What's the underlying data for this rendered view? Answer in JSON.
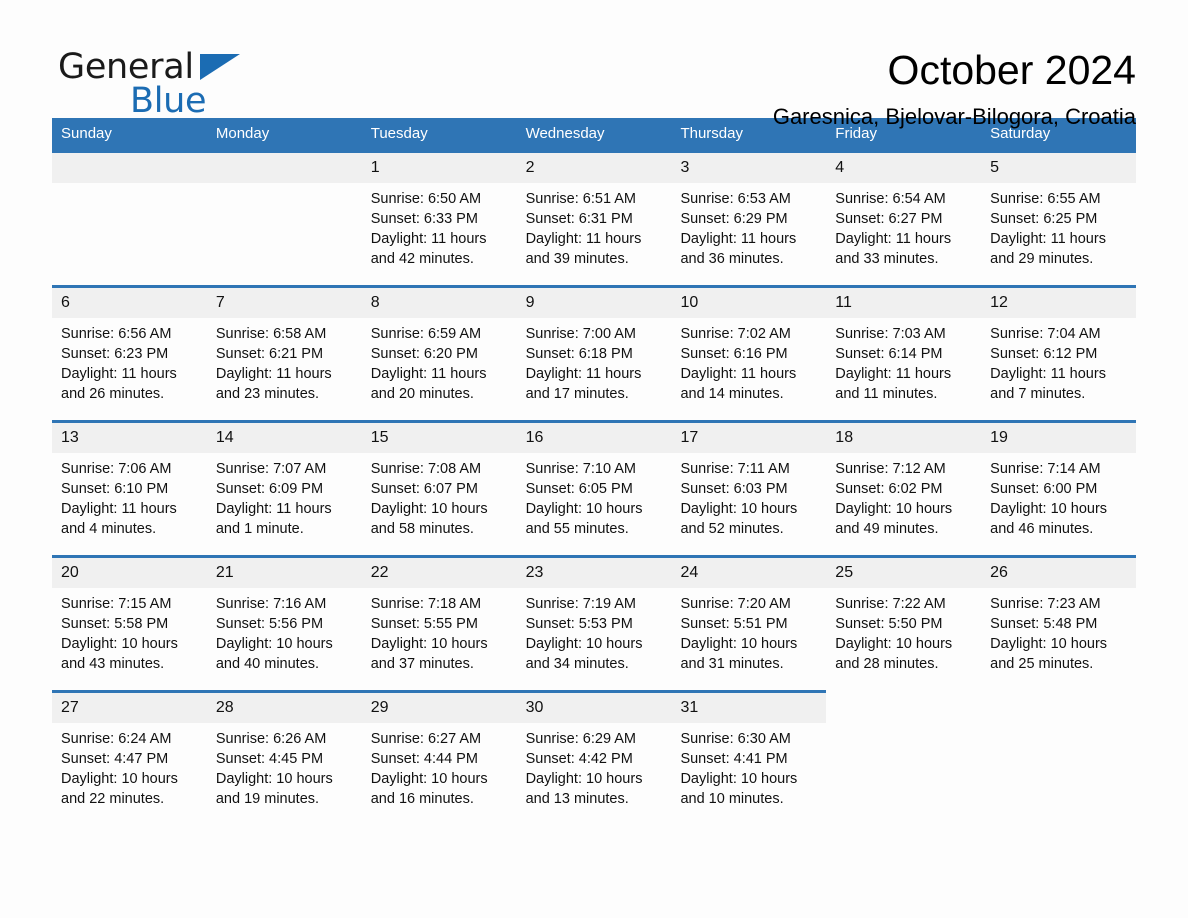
{
  "brand": {
    "name_part1": "General",
    "name_part2": "Blue",
    "triangle_color": "#1b6cb3"
  },
  "header": {
    "month_title": "October 2024",
    "location": "Garesnica, Bjelovar-Bilogora, Croatia"
  },
  "theme": {
    "header_blue": "#2f75b5",
    "day_band_gray": "#f0f0f0",
    "page_background": "#fdfdfd"
  },
  "weekdays": [
    "Sunday",
    "Monday",
    "Tuesday",
    "Wednesday",
    "Thursday",
    "Friday",
    "Saturday"
  ],
  "weeks": [
    [
      {
        "blank": true
      },
      {
        "blank": true
      },
      {
        "day": "1",
        "sunrise": "Sunrise: 6:50 AM",
        "sunset": "Sunset: 6:33 PM",
        "daylight": "Daylight: 11 hours and 42 minutes."
      },
      {
        "day": "2",
        "sunrise": "Sunrise: 6:51 AM",
        "sunset": "Sunset: 6:31 PM",
        "daylight": "Daylight: 11 hours and 39 minutes."
      },
      {
        "day": "3",
        "sunrise": "Sunrise: 6:53 AM",
        "sunset": "Sunset: 6:29 PM",
        "daylight": "Daylight: 11 hours and 36 minutes."
      },
      {
        "day": "4",
        "sunrise": "Sunrise: 6:54 AM",
        "sunset": "Sunset: 6:27 PM",
        "daylight": "Daylight: 11 hours and 33 minutes."
      },
      {
        "day": "5",
        "sunrise": "Sunrise: 6:55 AM",
        "sunset": "Sunset: 6:25 PM",
        "daylight": "Daylight: 11 hours and 29 minutes."
      }
    ],
    [
      {
        "day": "6",
        "sunrise": "Sunrise: 6:56 AM",
        "sunset": "Sunset: 6:23 PM",
        "daylight": "Daylight: 11 hours and 26 minutes."
      },
      {
        "day": "7",
        "sunrise": "Sunrise: 6:58 AM",
        "sunset": "Sunset: 6:21 PM",
        "daylight": "Daylight: 11 hours and 23 minutes."
      },
      {
        "day": "8",
        "sunrise": "Sunrise: 6:59 AM",
        "sunset": "Sunset: 6:20 PM",
        "daylight": "Daylight: 11 hours and 20 minutes."
      },
      {
        "day": "9",
        "sunrise": "Sunrise: 7:00 AM",
        "sunset": "Sunset: 6:18 PM",
        "daylight": "Daylight: 11 hours and 17 minutes."
      },
      {
        "day": "10",
        "sunrise": "Sunrise: 7:02 AM",
        "sunset": "Sunset: 6:16 PM",
        "daylight": "Daylight: 11 hours and 14 minutes."
      },
      {
        "day": "11",
        "sunrise": "Sunrise: 7:03 AM",
        "sunset": "Sunset: 6:14 PM",
        "daylight": "Daylight: 11 hours and 11 minutes."
      },
      {
        "day": "12",
        "sunrise": "Sunrise: 7:04 AM",
        "sunset": "Sunset: 6:12 PM",
        "daylight": "Daylight: 11 hours and 7 minutes."
      }
    ],
    [
      {
        "day": "13",
        "sunrise": "Sunrise: 7:06 AM",
        "sunset": "Sunset: 6:10 PM",
        "daylight": "Daylight: 11 hours and 4 minutes."
      },
      {
        "day": "14",
        "sunrise": "Sunrise: 7:07 AM",
        "sunset": "Sunset: 6:09 PM",
        "daylight": "Daylight: 11 hours and 1 minute."
      },
      {
        "day": "15",
        "sunrise": "Sunrise: 7:08 AM",
        "sunset": "Sunset: 6:07 PM",
        "daylight": "Daylight: 10 hours and 58 minutes."
      },
      {
        "day": "16",
        "sunrise": "Sunrise: 7:10 AM",
        "sunset": "Sunset: 6:05 PM",
        "daylight": "Daylight: 10 hours and 55 minutes."
      },
      {
        "day": "17",
        "sunrise": "Sunrise: 7:11 AM",
        "sunset": "Sunset: 6:03 PM",
        "daylight": "Daylight: 10 hours and 52 minutes."
      },
      {
        "day": "18",
        "sunrise": "Sunrise: 7:12 AM",
        "sunset": "Sunset: 6:02 PM",
        "daylight": "Daylight: 10 hours and 49 minutes."
      },
      {
        "day": "19",
        "sunrise": "Sunrise: 7:14 AM",
        "sunset": "Sunset: 6:00 PM",
        "daylight": "Daylight: 10 hours and 46 minutes."
      }
    ],
    [
      {
        "day": "20",
        "sunrise": "Sunrise: 7:15 AM",
        "sunset": "Sunset: 5:58 PM",
        "daylight": "Daylight: 10 hours and 43 minutes."
      },
      {
        "day": "21",
        "sunrise": "Sunrise: 7:16 AM",
        "sunset": "Sunset: 5:56 PM",
        "daylight": "Daylight: 10 hours and 40 minutes."
      },
      {
        "day": "22",
        "sunrise": "Sunrise: 7:18 AM",
        "sunset": "Sunset: 5:55 PM",
        "daylight": "Daylight: 10 hours and 37 minutes."
      },
      {
        "day": "23",
        "sunrise": "Sunrise: 7:19 AM",
        "sunset": "Sunset: 5:53 PM",
        "daylight": "Daylight: 10 hours and 34 minutes."
      },
      {
        "day": "24",
        "sunrise": "Sunrise: 7:20 AM",
        "sunset": "Sunset: 5:51 PM",
        "daylight": "Daylight: 10 hours and 31 minutes."
      },
      {
        "day": "25",
        "sunrise": "Sunrise: 7:22 AM",
        "sunset": "Sunset: 5:50 PM",
        "daylight": "Daylight: 10 hours and 28 minutes."
      },
      {
        "day": "26",
        "sunrise": "Sunrise: 7:23 AM",
        "sunset": "Sunset: 5:48 PM",
        "daylight": "Daylight: 10 hours and 25 minutes."
      }
    ],
    [
      {
        "day": "27",
        "sunrise": "Sunrise: 6:24 AM",
        "sunset": "Sunset: 4:47 PM",
        "daylight": "Daylight: 10 hours and 22 minutes."
      },
      {
        "day": "28",
        "sunrise": "Sunrise: 6:26 AM",
        "sunset": "Sunset: 4:45 PM",
        "daylight": "Daylight: 10 hours and 19 minutes."
      },
      {
        "day": "29",
        "sunrise": "Sunrise: 6:27 AM",
        "sunset": "Sunset: 4:44 PM",
        "daylight": "Daylight: 10 hours and 16 minutes."
      },
      {
        "day": "30",
        "sunrise": "Sunrise: 6:29 AM",
        "sunset": "Sunset: 4:42 PM",
        "daylight": "Daylight: 10 hours and 13 minutes."
      },
      {
        "day": "31",
        "sunrise": "Sunrise: 6:30 AM",
        "sunset": "Sunset: 4:41 PM",
        "daylight": "Daylight: 10 hours and 10 minutes."
      },
      {
        "blank": true
      },
      {
        "blank": true
      }
    ]
  ]
}
